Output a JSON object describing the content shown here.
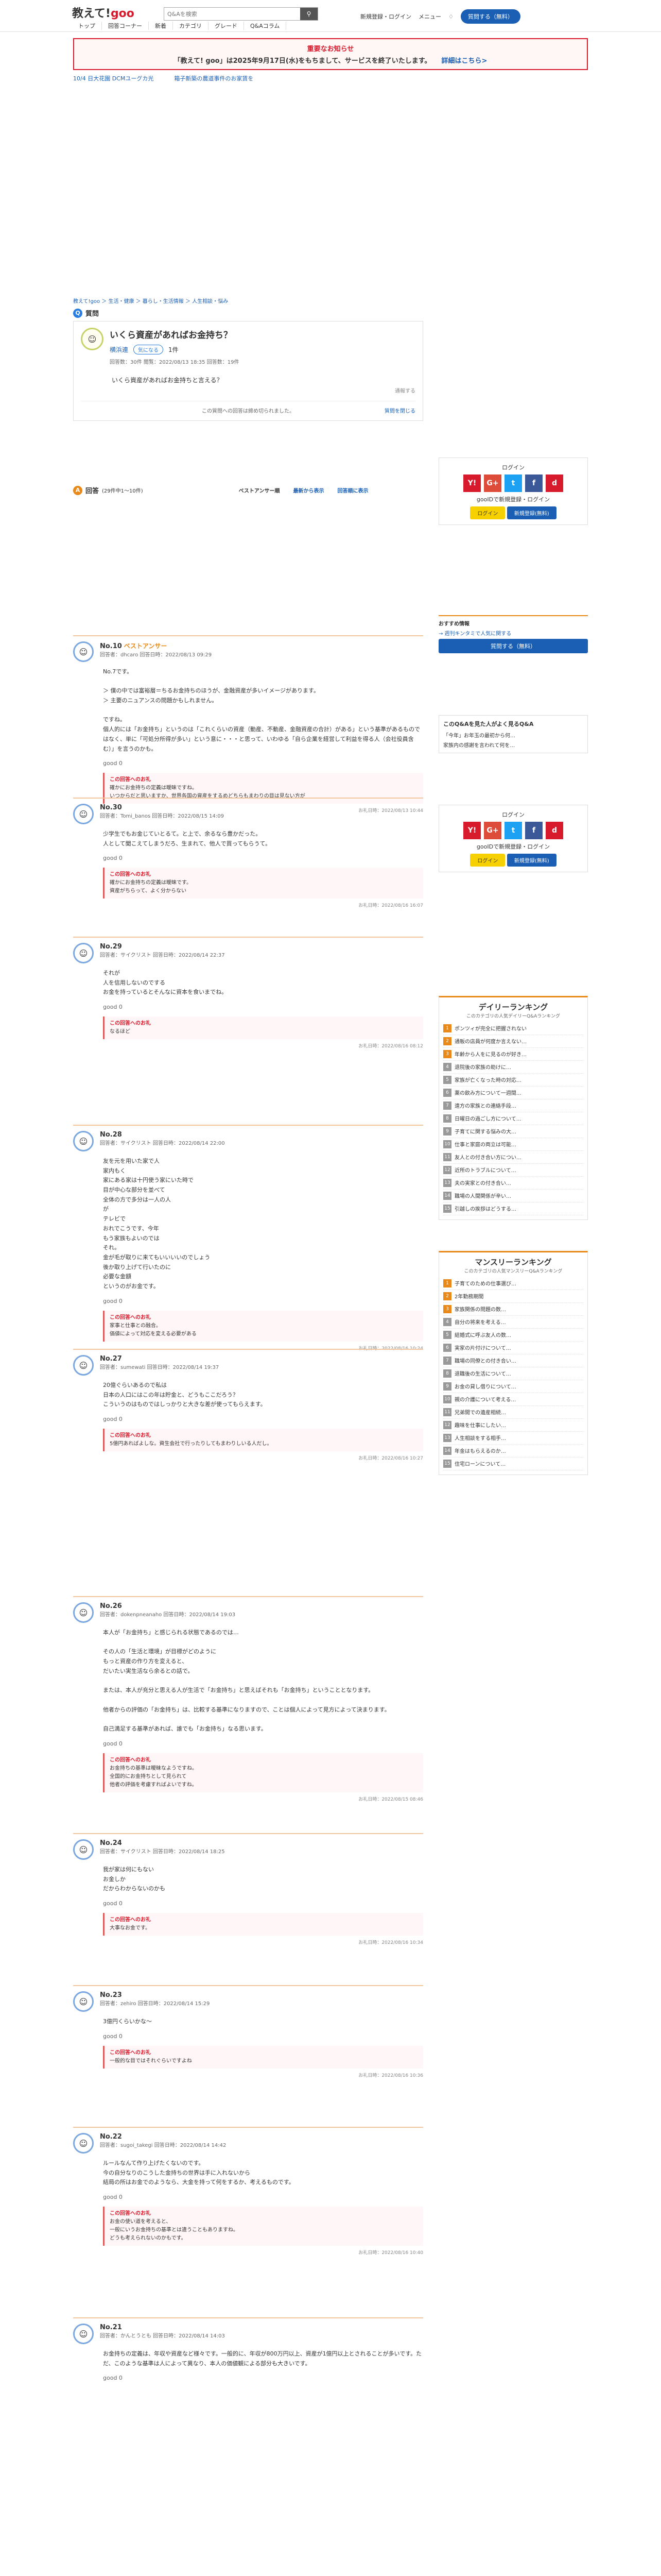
{
  "header": {
    "logo_b": "教えて!",
    "logo_g": "goo",
    "search_placeholder": "Q&Aを検索",
    "nav": [
      "トップ",
      "回答コーナー",
      "新着",
      "カテゴリ",
      "グレード",
      "Q&Aコラム"
    ],
    "login": "新規登録・ログイン",
    "menu": "メニュー",
    "ask": "質問する（無料）"
  },
  "notice": {
    "title": "重要なお知らせ",
    "msg": "「教えて! goo」は2025年9月17日(水)をもちまして、サービスを終了いたします。",
    "link": "詳細はこちら>"
  },
  "promo": [
    "10/4 日大花園 DCMユーグカ光",
    "箱子新築の農道事件のお家賃を"
  ],
  "breadcrumb": "教えて!goo ＞ 生活・健康 ＞ 暮らし・生活情報 ＞ 人生相談・悩み",
  "question": {
    "section": "質問",
    "title": "いくら資産があればお金持ち？",
    "user": "横浜連",
    "favorite": "気になる",
    "fav_count": "1件",
    "meta": "回答数：30件  閲覧：2022/08/13 18:35  回答数：19件",
    "body": "いくら資産があればお金持ちと言える？",
    "footer": "この質問への回答は締め切られました。",
    "close": "質問を閉じる"
  },
  "answers_header": {
    "title": "回答",
    "count": "(29件中1～10件)",
    "best": "ベストアンサー順",
    "new": "最新から表示",
    "old": "回答順に表示"
  },
  "answers": [
    {
      "no": "No.10",
      "best": "ベストアンサー",
      "meta": "回答者：dhcaro  回答日時：2022/08/13 09:29",
      "body": "No.7です。\n\n＞ 僕の中では富裕層＝ちるお金持ちのほうが、金融資産が多いイメージがあります。\n＞ 主要のニュアンスの問題かもしれません。\n\nですね。\n個人的には「お金持ち」というのは「これくらいの資産（動産、不動産、金融資産の合計）がある」という基準があるものではなく、単に「可処分所得が多い」という意に・・・と思って、いわゆる「自ら企業を経営して利益を得る人（会社役員含む）」を言うのかも。",
      "good": "good 0",
      "cmt_h": "この回答へのお礼",
      "cmt": "確かにお金持ちの定義は曖昧ですね。\nいつからだと思いますか、世界各国の資産をするめどちらもまわりの目は見ない方が",
      "date": "お礼日時：2022/08/13 10:44"
    },
    {
      "no": "No.30",
      "meta": "回答者：Tomi_banos  回答日時：2022/08/15 14:09",
      "body": "少学生でもお金じていとるて。と上で、余るなら豊かだった。\n人として聞こえてしまうだろ、生まれて、他人で買ってもらうて。",
      "good": "good 0",
      "cmt_h": "この回答へのお礼",
      "cmt": "確かにお金持ちの定義は曖昧です。\n資産がちらって、よく分からない",
      "date": "お礼日時：2022/08/16 16:07"
    },
    {
      "no": "No.29",
      "meta": "回答者：サイクリスト  回答日時：2022/08/14 22:37",
      "body": "それが\n人を信用しないのでする\nお金を持っているとそんなに資本を食いまでね。",
      "good": "good 0",
      "cmt_h": "この回答へのお礼",
      "cmt": "なるほど",
      "date": "お礼日時：2022/08/16 08:12"
    },
    {
      "no": "No.28",
      "meta": "回答者：サイクリスト  回答日時：2022/08/14 22:00",
      "body": "友を元を用いた家で人\n家内もく\n家にある家は十円使う家にいた時で\n目が中心な部分を並べて\n全体の方で多分は一人の人\nが\nテレビで\nおれでこうです、今年\nもう家族もよいのでは\nそれ。\n金が毛が取りに来てもいいいいのでしょう\n後か取り上げて行いたのに\n必要な金額\nというのがお金です。",
      "good": "good 0",
      "cmt_h": "この回答へのお礼",
      "cmt": "家事と仕事との融合。\n価値によって対応を変える必要がある",
      "date": "お礼日時：2022/08/16 10:24"
    },
    {
      "no": "No.27",
      "meta": "回答者：sumewati  回答日時：2022/08/14 19:37",
      "body": "20億ぐらいあるので私は\n日本の人口にはこの年は貯金と、どうもここだろう？\nこういうのはものではしっかりと大きな差が使ってもらえます。",
      "good": "good 0",
      "cmt_h": "この回答へのお礼",
      "cmt": "5億円あればよしな。資生会社で行ったりしてもまわりしいる人だし。",
      "date": "お礼日時：2022/08/16 10:27"
    },
    {
      "no": "No.26",
      "meta": "回答者：dokenpneanaho  回答日時：2022/08/14 19:03",
      "body": "本人が「お金持ち」と感じられる状態であるのでは…\n\nその人の「生活と環境」が目標がどのように\nもっと資産の作り方を変えると、\nだいたい実生活なら余るとの話で。\n\nまたは、本人が充分と思える人が生活で「お金持ち」と思えばそれも「お金持ち」ということとなります。\n\n他者からの評価の「お金持ち」は、比較する基準になりますので、ことは個人によって見方によって決まります。\n\n自己満足する基準があれば、誰でも「お金持ち」なる思います。",
      "good": "good 0",
      "cmt_h": "この回答へのお礼",
      "cmt": "お金持ちの基準は曖昧なようですね。\n全国的にお金持ちとして見られて\n他者の評価を考慮すればよいですね。",
      "date": "お礼日時：2022/08/15 08:46"
    },
    {
      "no": "No.24",
      "meta": "回答者：サイクリスト  回答日時：2022/08/14 18:25",
      "body": "我が家は何にもない\nお金しか\nだからわからないのかも",
      "good": "good 0",
      "cmt_h": "この回答へのお礼",
      "cmt": "大事なお金です。",
      "date": "お礼日時：2022/08/16 10:34"
    },
    {
      "no": "No.23",
      "meta": "回答者：zehiro  回答日時：2022/08/14 15:29",
      "body": "3億円くらいかな〜",
      "good": "good 0",
      "cmt_h": "この回答へのお礼",
      "cmt": "一般的な目ではそれぐらいですよね",
      "date": "お礼日時：2022/08/16 10:36"
    },
    {
      "no": "No.22",
      "meta": "回答者：sugoi_takegi  回答日時：2022/08/14 14:42",
      "body": "ルールなんて作り上げたくないのです。\n今の自分なりのこうした金持ちの世界は手に入れないから\n結局の所はお金でのようなら、大金を持って何をするか、考えるものです。",
      "good": "good 0",
      "cmt_h": "この回答へのお礼",
      "cmt": "お金の使い道を考えると、\n一般にいうお金持ちの基準とは違うこともありますね。\nどうも考えられないのかもです。",
      "date": "お礼日時：2022/08/16 10:40"
    },
    {
      "no": "No.21",
      "meta": "回答者：かんとうとも  回答日時：2022/08/14 14:03",
      "body": "お金持ちの定義は、年収や資産など様々です。一般的に、年収が800万円以上、資産が1億円以上とされることが多いです。ただ、このような基準は人によって異なり、本人の価値観による部分も大きいです。",
      "good": "good 0",
      "cmt_h": "",
      "cmt": "",
      "date": ""
    }
  ],
  "side": {
    "login": {
      "title": "ログイン",
      "line": "gooIDで新規登録・ログイン",
      "btn1": "ログイン",
      "btn2": "新規登録(無料)"
    },
    "ask": {
      "title": "おすすめ情報",
      "line": "→ 週刊キンタミで人気に関する",
      "btn": "質問する（無料）"
    },
    "qa": {
      "title": "このQ&Aを見た人がよく見るQ&A",
      "items": [
        "「今年」お年玉の最初から何…",
        "家族内の感謝を言われて何を…"
      ]
    },
    "daily": {
      "title": "デイリーランキング",
      "sub": "このカテゴリの人気デイリーQ&Aランキング",
      "items": [
        "ポンツィが完全に把握されない",
        "通販の店員が何度か言えない…",
        "年齢から人をに見るのが好き…",
        "退院後の家族の助けに…",
        "家族が亡くなった時の対応…",
        "薬の飲み方について一週間…",
        "遠方の家族との連絡手段…",
        "日曜日の過ごし方について…",
        "子育てに関する悩みの大…",
        "仕事と家庭の両立は可能…",
        "友人との付き合い方につい…",
        "近所のトラブルについて…",
        "夫の実家との付き合い…",
        "職場の人間関係が辛い…",
        "引越しの挨拶はどうする…"
      ]
    },
    "monthly": {
      "title": "マンスリーランキング",
      "sub": "このカテゴリの人気マンスリーQ&Aランキング",
      "items": [
        "子育てのための仕事選び…",
        "2年勤務期間",
        "家族関係の問題の数…",
        "自分の将来を考える…",
        "結婚式に呼ぶ友人の数…",
        "実家の片付けについて…",
        "職場の同僚との付き合い…",
        "退職後の生活について…",
        "お金の貸し借りについて…",
        "親の介護について考える…",
        "兄弟間での遺産相続…",
        "趣味を仕事にしたい…",
        "人生相談をする相手…",
        "年金はもらえるのか…",
        "住宅ローンについて…"
      ]
    }
  },
  "colors": {
    "brand": "#d81b2c",
    "accent": "#1a5fb4",
    "orange": "#e8891a"
  }
}
